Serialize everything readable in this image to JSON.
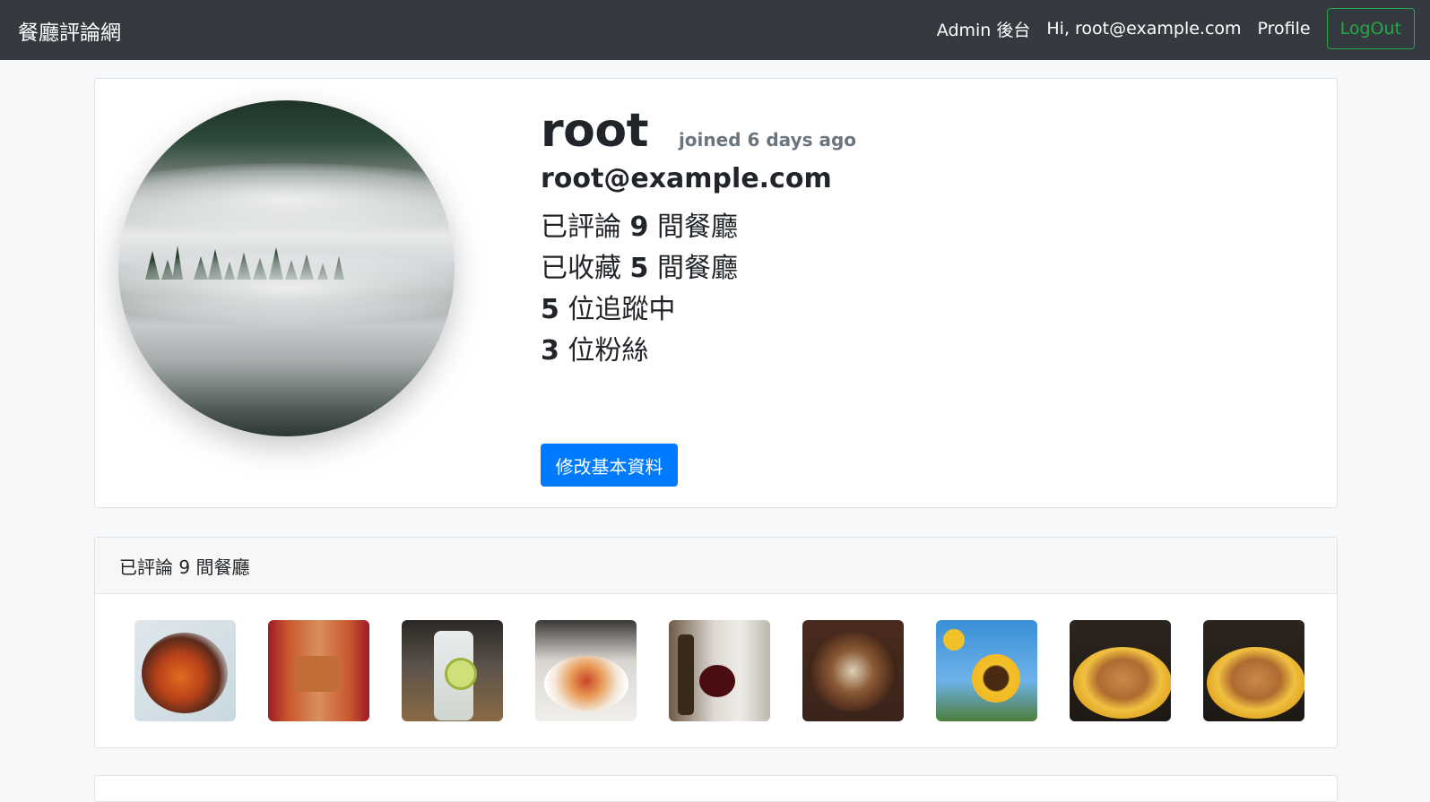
{
  "navbar": {
    "brand": "餐廳評論網",
    "admin_link": "Admin 後台",
    "greeting": "Hi, root@example.com",
    "profile_link": "Profile",
    "logout_button": "LogOut"
  },
  "profile": {
    "username": "root",
    "joined": "joined 6 days ago",
    "email": "root@example.com",
    "stats": {
      "reviewed_prefix": "已評論 ",
      "reviewed_count": "9",
      "reviewed_suffix": " 間餐廳",
      "favorited_prefix": "已收藏 ",
      "favorited_count": "5",
      "favorited_suffix": " 間餐廳",
      "following_count": "5",
      "following_suffix": " 位追蹤中",
      "followers_count": "3",
      "followers_suffix": " 位粉絲"
    },
    "edit_button": "修改基本資料",
    "avatar_icon": "foggy-forest-avatar"
  },
  "reviews": {
    "header": "已評論 9 間餐廳",
    "thumbnails": [
      {
        "icon": "food-photo-carrots"
      },
      {
        "icon": "food-photo-fries"
      },
      {
        "icon": "drink-photo-lemon"
      },
      {
        "icon": "food-photo-plated-dish"
      },
      {
        "icon": "drink-photo-wine"
      },
      {
        "icon": "food-photo-stew"
      },
      {
        "icon": "photo-sunflower"
      },
      {
        "icon": "food-photo-bread"
      },
      {
        "icon": "food-photo-bread"
      }
    ]
  }
}
